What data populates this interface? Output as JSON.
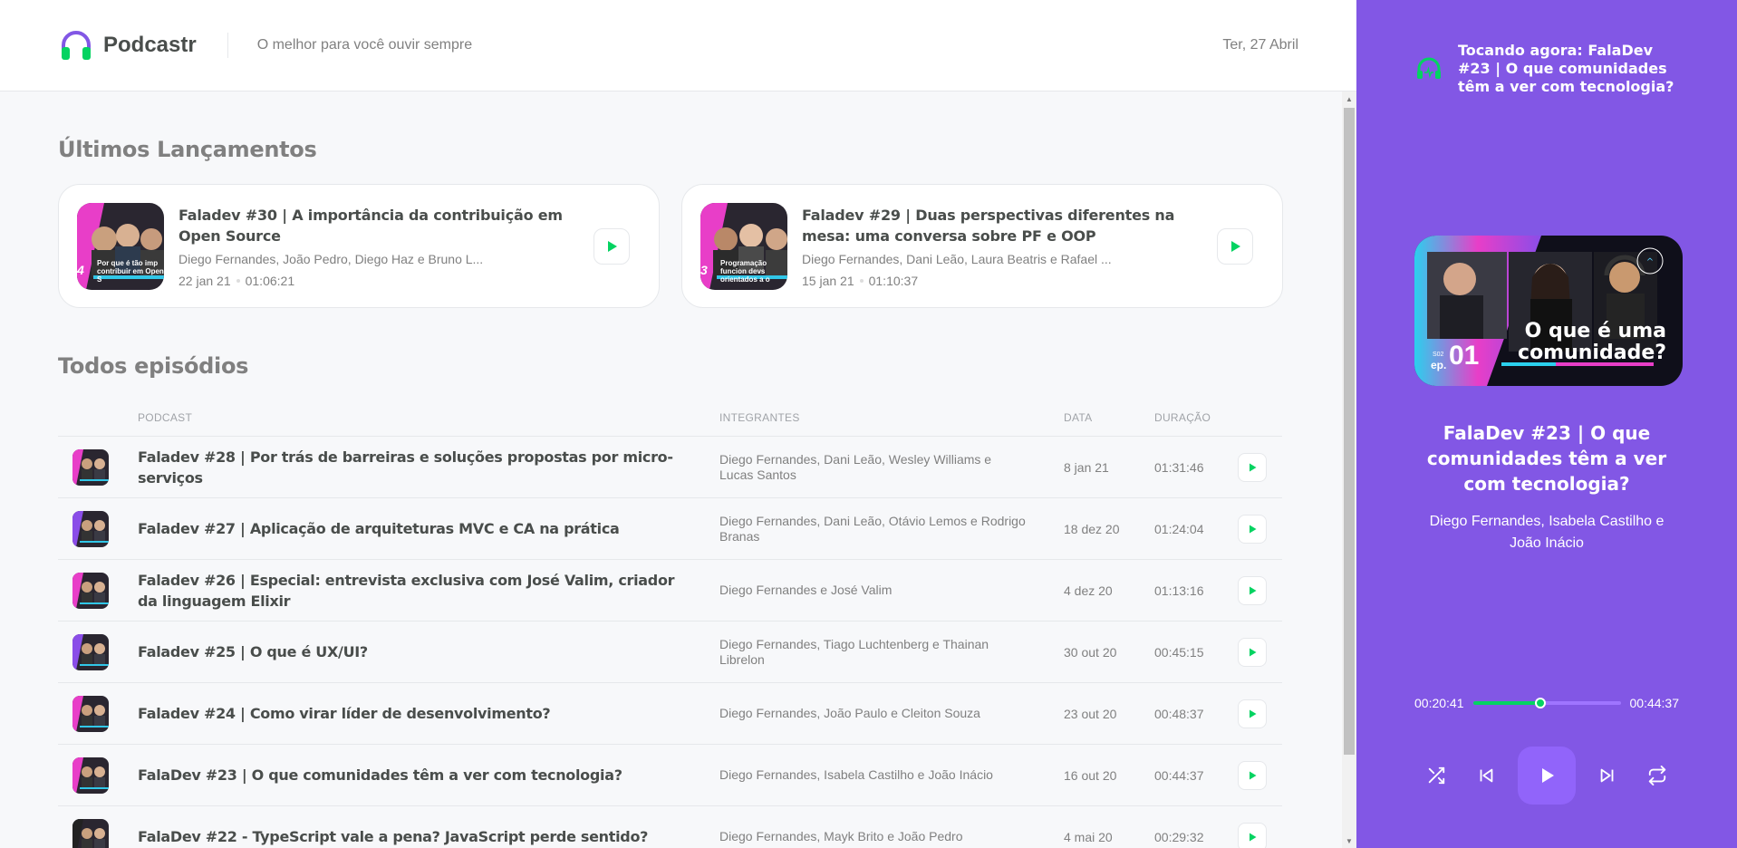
{
  "header": {
    "logo_text": "Podcastr",
    "tagline": "O melhor para você ouvir sempre",
    "date": "Ter, 27 Abril"
  },
  "latest": {
    "title": "Últimos Lançamentos",
    "items": [
      {
        "title": "Faladev #30 | A importância da contribuição em Open Source",
        "members": "Diego Fernandes, João Pedro, Diego Haz e Bruno L...",
        "date": "22 jan 21",
        "duration": "01:06:21",
        "thumb_caption": "Por que é tão imp contribuir em Open S",
        "thumb_num": "4"
      },
      {
        "title": "Faladev #29 | Duas perspectivas diferentes na mesa: uma conversa sobre PF e OOP",
        "members": "Diego Fernandes, Dani Leão, Laura Beatris e Rafael ...",
        "date": "15 jan 21",
        "duration": "01:10:37",
        "thumb_caption": "Programação funcion devs orientados a o",
        "thumb_num": "3"
      }
    ]
  },
  "all": {
    "title": "Todos episódios",
    "columns": [
      "Podcast",
      "Integrantes",
      "Data",
      "Duração"
    ],
    "rows": [
      {
        "title": "Faladev #28 | Por trás de barreiras e soluções propostas por micro-serviços",
        "members": "Diego Fernandes, Dani Leão, Wesley Williams e Lucas Santos",
        "date": "8 jan 21",
        "duration": "01:31:46"
      },
      {
        "title": "Faladev #27 | Aplicação de arquiteturas MVC e CA na prática",
        "members": "Diego Fernandes, Dani Leão, Otávio Lemos e Rodrigo Branas",
        "date": "18 dez 20",
        "duration": "01:24:04"
      },
      {
        "title": "Faladev #26 | Especial: entrevista exclusiva com José Valim, criador da linguagem Elixir",
        "members": "Diego Fernandes e José Valim",
        "date": "4 dez 20",
        "duration": "01:13:16"
      },
      {
        "title": "Faladev #25 | O que é UX/UI?",
        "members": "Diego Fernandes, Tiago Luchtenberg e Thainan Librelon",
        "date": "30 out 20",
        "duration": "00:45:15"
      },
      {
        "title": "Faladev #24 | Como virar líder de desenvolvimento?",
        "members": "Diego Fernandes, João Paulo e Cleiton Souza",
        "date": "23 out 20",
        "duration": "00:48:37"
      },
      {
        "title": "FalaDev #23 | O que comunidades têm a ver com tecnologia?",
        "members": "Diego Fernandes, Isabela Castilho e João Inácio",
        "date": "16 out 20",
        "duration": "00:44:37"
      },
      {
        "title": "FalaDev #22 - TypeScript vale a pena? JavaScript perde sentido?",
        "members": "Diego Fernandes, Mayk Brito e João Pedro",
        "date": "4 mai 20",
        "duration": "00:29:32"
      }
    ]
  },
  "player": {
    "now_playing": "Tocando agora: FalaDev #23 | O que comunidades têm a ver com tecnologia?",
    "cover_text_line1": "O que é uma",
    "cover_text_line2": "comunidade?",
    "cover_ep_label": "ep.",
    "cover_ep_season": "S02",
    "cover_ep_number": "01",
    "title": "FalaDev #23 | O que comunidades têm a ver com tecnologia?",
    "members": "Diego Fernandes, Isabela Castilho e João Inácio",
    "current_time": "00:20:41",
    "total_time": "00:44:37",
    "progress": 0.46,
    "colors": {
      "background": "#8257e5",
      "accent": "#04d361",
      "play_button": "#9164fa"
    }
  }
}
